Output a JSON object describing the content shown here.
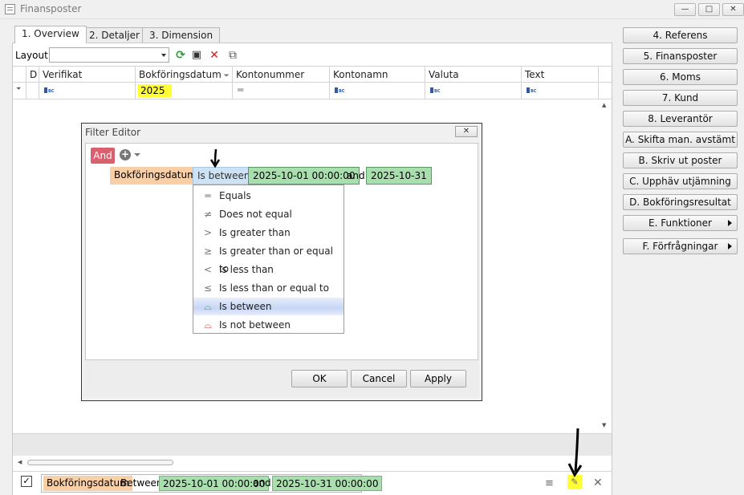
{
  "window": {
    "title": "Finansposter",
    "minimize": "—",
    "maximize": "□",
    "close": "✕"
  },
  "tabs": [
    {
      "label": "1. Overview"
    },
    {
      "label": "2. Detaljer"
    },
    {
      "label": "3. Dimension"
    }
  ],
  "toolbar": {
    "layout_label": "Layout",
    "layout_value": ""
  },
  "grid": {
    "columns": [
      {
        "label": "D"
      },
      {
        "label": "Verifikat"
      },
      {
        "label": "Bokföringsdatum"
      },
      {
        "label": "Kontonummer"
      },
      {
        "label": "Kontonamn"
      },
      {
        "label": "Valuta"
      },
      {
        "label": "Text"
      }
    ],
    "filter_row": {
      "bokforingsdatum": "2025",
      "kontonummer": "="
    }
  },
  "side_buttons": [
    {
      "label": "4. Referens"
    },
    {
      "label": "5. Finansposter"
    },
    {
      "label": "6. Moms"
    },
    {
      "label": "7. Kund"
    },
    {
      "label": "8. Leverantör"
    },
    {
      "label": "A. Skifta man. avstämt"
    },
    {
      "label": "B. Skriv ut poster"
    },
    {
      "label": "C. Upphäv utjämning"
    },
    {
      "label": "D. Bokföringsresultat"
    },
    {
      "label": "E. Funktioner"
    },
    {
      "label": "F. Förfrågningar"
    }
  ],
  "filter_editor": {
    "title": "Filter Editor",
    "group_op": "And",
    "field": "Bokföringsdatum",
    "operator": "Is between",
    "value1": "2025-10-01 00:00:00",
    "and_word": "and",
    "value2": "2025-10-31",
    "operators": [
      {
        "label": "Equals",
        "icon": "═"
      },
      {
        "label": "Does not equal",
        "icon": "≠"
      },
      {
        "label": "Is greater than",
        "icon": ">"
      },
      {
        "label": "Is greater than or equal to",
        "icon": "≥"
      },
      {
        "label": "Is less than",
        "icon": "<"
      },
      {
        "label": "Is less than or equal to",
        "icon": "≤"
      },
      {
        "label": "Is between",
        "icon": "⌓"
      },
      {
        "label": "Is not between",
        "icon": "⌓"
      }
    ],
    "selected_operator_index": 6,
    "ok": "OK",
    "cancel": "Cancel",
    "apply": "Apply"
  },
  "filter_panel": {
    "field": "Bokföringsdatum",
    "op": "Between",
    "value1": "2025-10-01 00:00:00",
    "and_word": "and",
    "value2": "2025-10-31 00:00:00"
  },
  "colors": {
    "and_red": "#d9606e",
    "field_orange": "#f9cfa8",
    "value_green": "#a9dfae",
    "operator_blue": "#cde3f5",
    "highlight_yellow": "#ffff33"
  }
}
